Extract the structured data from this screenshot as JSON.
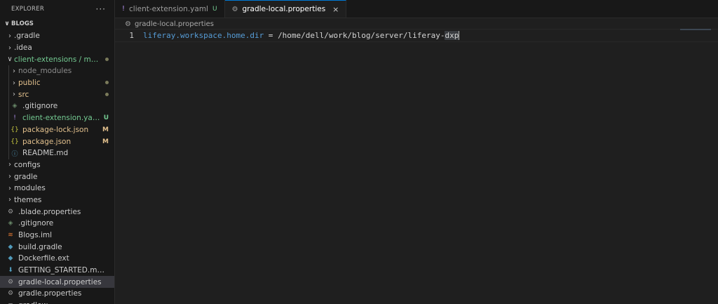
{
  "explorer": {
    "title": "EXPLORER",
    "more": "···"
  },
  "section": {
    "chevron": "∨",
    "title": "BLOGS"
  },
  "tree": [
    {
      "indent": 0,
      "chev": "›",
      "icon": "",
      "icon_name": "",
      "label": ".gradle",
      "color": "#cccccc",
      "status": "",
      "status_color": ""
    },
    {
      "indent": 0,
      "chev": "›",
      "icon": "",
      "icon_name": "",
      "label": ".idea",
      "color": "#cccccc",
      "status": "",
      "status_color": ""
    },
    {
      "indent": 0,
      "chev": "∨",
      "icon": "",
      "icon_name": "",
      "label": "client-extensions / my-r...",
      "color": "#73c991",
      "status": "dot",
      "status_color": ""
    },
    {
      "indent": 1,
      "chev": "›",
      "icon": "",
      "icon_name": "",
      "label": "node_modules",
      "color": "#8c8c8c",
      "status": "",
      "status_color": ""
    },
    {
      "indent": 1,
      "chev": "›",
      "icon": "",
      "icon_name": "",
      "label": "public",
      "color": "#e2c08d",
      "status": "dot",
      "status_color": ""
    },
    {
      "indent": 1,
      "chev": "›",
      "icon": "",
      "icon_name": "",
      "label": "src",
      "color": "#e2c08d",
      "status": "dot",
      "status_color": ""
    },
    {
      "indent": 1,
      "chev": "",
      "icon": "◈",
      "icon_name": "git-icon",
      "label": ".gitignore",
      "color": "#cccccc",
      "status": "",
      "status_color": "",
      "icon_color": "#6a8a6a"
    },
    {
      "indent": 1,
      "chev": "",
      "icon": "!",
      "icon_name": "yaml-icon",
      "label": "client-extension.yaml",
      "color": "#73c991",
      "status": "U",
      "status_color": "#73c991",
      "icon_color": "#b392f0"
    },
    {
      "indent": 1,
      "chev": "",
      "icon": "{}",
      "icon_name": "json-icon",
      "label": "package-lock.json",
      "color": "#e2c08d",
      "status": "M",
      "status_color": "#e2c08d",
      "icon_color": "#cbcb41"
    },
    {
      "indent": 1,
      "chev": "",
      "icon": "{}",
      "icon_name": "json-icon",
      "label": "package.json",
      "color": "#e2c08d",
      "status": "M",
      "status_color": "#e2c08d",
      "icon_color": "#cbcb41"
    },
    {
      "indent": 1,
      "chev": "",
      "icon": "ⓘ",
      "icon_name": "info-icon",
      "label": "README.md",
      "color": "#cccccc",
      "status": "",
      "status_color": "",
      "icon_color": "#519aba"
    },
    {
      "indent": 0,
      "chev": "›",
      "icon": "",
      "icon_name": "",
      "label": "configs",
      "color": "#cccccc",
      "status": "",
      "status_color": ""
    },
    {
      "indent": 0,
      "chev": "›",
      "icon": "",
      "icon_name": "",
      "label": "gradle",
      "color": "#cccccc",
      "status": "",
      "status_color": ""
    },
    {
      "indent": 0,
      "chev": "›",
      "icon": "",
      "icon_name": "",
      "label": "modules",
      "color": "#cccccc",
      "status": "",
      "status_color": ""
    },
    {
      "indent": 0,
      "chev": "›",
      "icon": "",
      "icon_name": "",
      "label": "themes",
      "color": "#cccccc",
      "status": "",
      "status_color": ""
    },
    {
      "indent": 0,
      "chev": "",
      "icon": "⚙",
      "icon_name": "gear-icon",
      "label": ".blade.properties",
      "color": "#cccccc",
      "status": "",
      "status_color": "",
      "icon_color": "#9d9d9d"
    },
    {
      "indent": 0,
      "chev": "",
      "icon": "◈",
      "icon_name": "git-icon",
      "label": ".gitignore",
      "color": "#cccccc",
      "status": "",
      "status_color": "",
      "icon_color": "#6a8a6a"
    },
    {
      "indent": 0,
      "chev": "",
      "icon": "≋",
      "icon_name": "rss-icon",
      "label": "Blogs.iml",
      "color": "#cccccc",
      "status": "",
      "status_color": "",
      "icon_color": "#e37933"
    },
    {
      "indent": 0,
      "chev": "",
      "icon": "◆",
      "icon_name": "gradle-icon",
      "label": "build.gradle",
      "color": "#cccccc",
      "status": "",
      "status_color": "",
      "icon_color": "#519aba"
    },
    {
      "indent": 0,
      "chev": "",
      "icon": "◆",
      "icon_name": "docker-icon",
      "label": "Dockerfile.ext",
      "color": "#cccccc",
      "status": "",
      "status_color": "",
      "icon_color": "#519aba"
    },
    {
      "indent": 0,
      "chev": "",
      "icon": "⬇",
      "icon_name": "markdown-icon",
      "label": "GETTING_STARTED.markdown",
      "color": "#cccccc",
      "status": "",
      "status_color": "",
      "icon_color": "#519aba"
    },
    {
      "indent": 0,
      "chev": "",
      "icon": "⚙",
      "icon_name": "gear-icon",
      "label": "gradle-local.properties",
      "color": "#cccccc",
      "status": "",
      "status_color": "",
      "icon_color": "#9d9d9d",
      "selected": true
    },
    {
      "indent": 0,
      "chev": "",
      "icon": "⚙",
      "icon_name": "gear-icon",
      "label": "gradle.properties",
      "color": "#cccccc",
      "status": "",
      "status_color": "",
      "icon_color": "#9d9d9d"
    },
    {
      "indent": 0,
      "chev": "",
      "icon": "≡",
      "icon_name": "file-icon",
      "label": "gradlew",
      "color": "#cccccc",
      "status": "",
      "status_color": "",
      "icon_color": "#9d9d9d"
    }
  ],
  "tabs": [
    {
      "icon": "!",
      "icon_name": "yaml-icon",
      "label": "client-extension.yaml",
      "status": "U",
      "active": false
    },
    {
      "icon": "⚙",
      "icon_name": "gear-icon",
      "label": "gradle-local.properties",
      "status": "",
      "active": true,
      "close": "×"
    }
  ],
  "breadcrumb": {
    "icon": "⚙",
    "label": "gradle-local.properties"
  },
  "code": {
    "line_number": "1",
    "key": "liferay.workspace.home.dir",
    "op": " = ",
    "value": "/home/dell/work/blog/server/liferay-",
    "value_selected": "dxp"
  }
}
